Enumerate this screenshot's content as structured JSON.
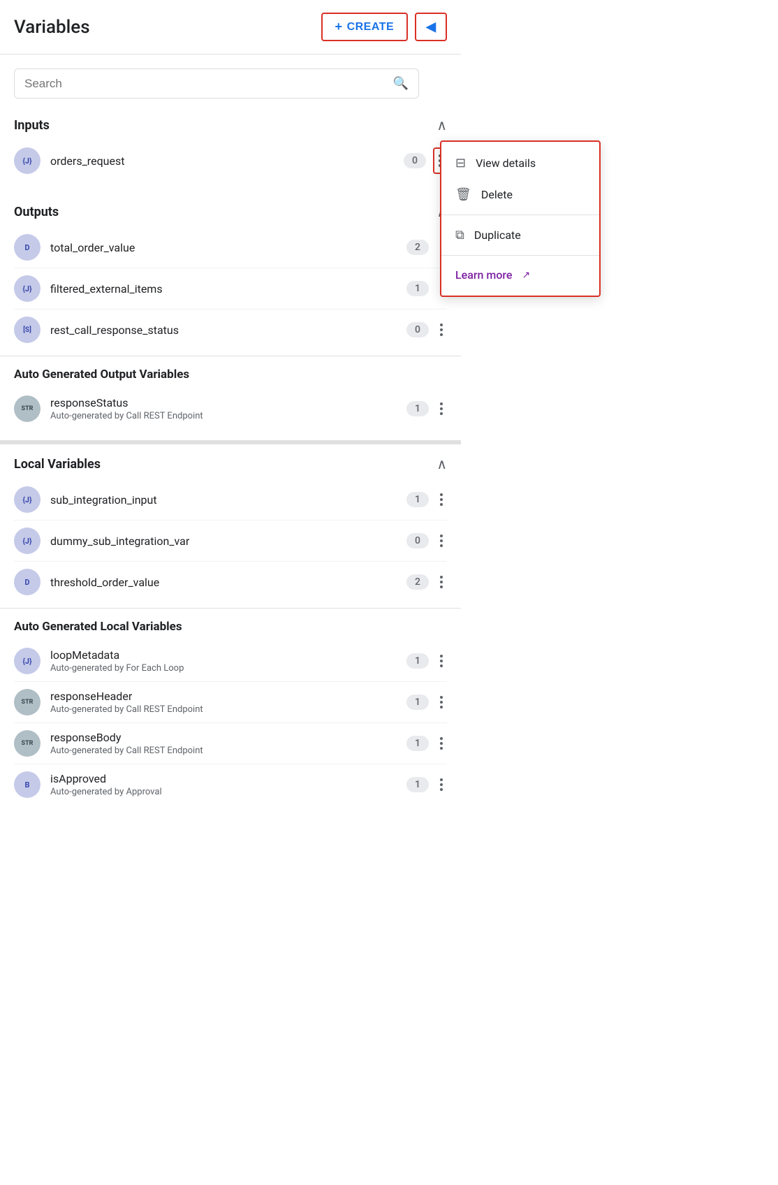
{
  "page": {
    "title": "Variables"
  },
  "header": {
    "title": "Variables",
    "create_label": "CREATE",
    "collapse_icon": "◀"
  },
  "search": {
    "placeholder": "Search"
  },
  "sections": {
    "inputs": {
      "title": "Inputs",
      "variables": [
        {
          "id": "orders_request",
          "icon": "{J}",
          "name": "orders_request",
          "count": "0"
        }
      ]
    },
    "outputs": {
      "title": "Outputs",
      "variables": [
        {
          "id": "total_order_value",
          "icon": "D",
          "name": "total_order_value",
          "count": "2"
        },
        {
          "id": "filtered_external_items",
          "icon": "{J}",
          "name": "filtered_external_items",
          "count": "1"
        },
        {
          "id": "rest_call_response_status",
          "icon": "S",
          "name": "rest_call_response_status",
          "count": "0"
        }
      ]
    },
    "auto_output": {
      "title": "Auto Generated Output Variables",
      "variables": [
        {
          "id": "responseStatus",
          "icon": "STR",
          "name": "responseStatus",
          "subtitle": "Auto-generated by Call REST Endpoint",
          "count": "1"
        }
      ]
    },
    "local": {
      "title": "Local Variables",
      "variables": [
        {
          "id": "sub_integration_input",
          "icon": "{J}",
          "name": "sub_integration_input",
          "count": "1"
        },
        {
          "id": "dummy_sub_integration_var",
          "icon": "{J}",
          "name": "dummy_sub_integration_var",
          "count": "0"
        },
        {
          "id": "threshold_order_value",
          "icon": "D",
          "name": "threshold_order_value",
          "count": "2"
        }
      ]
    },
    "auto_local": {
      "title": "Auto Generated Local Variables",
      "variables": [
        {
          "id": "loopMetadata",
          "icon": "{J}",
          "name": "loopMetadata",
          "subtitle": "Auto-generated by For Each Loop",
          "count": "1"
        },
        {
          "id": "responseHeader",
          "icon": "STR",
          "name": "responseHeader",
          "subtitle": "Auto-generated by Call REST Endpoint",
          "count": "1"
        },
        {
          "id": "responseBody",
          "icon": "STR",
          "name": "responseBody",
          "subtitle": "Auto-generated by Call REST Endpoint",
          "count": "1"
        },
        {
          "id": "isApproved",
          "icon": "B",
          "name": "isApproved",
          "subtitle": "Auto-generated by Approval",
          "count": "1"
        }
      ]
    }
  },
  "dropdown": {
    "view_details": "View details",
    "delete": "Delete",
    "duplicate": "Duplicate",
    "learn_more": "Learn more"
  }
}
